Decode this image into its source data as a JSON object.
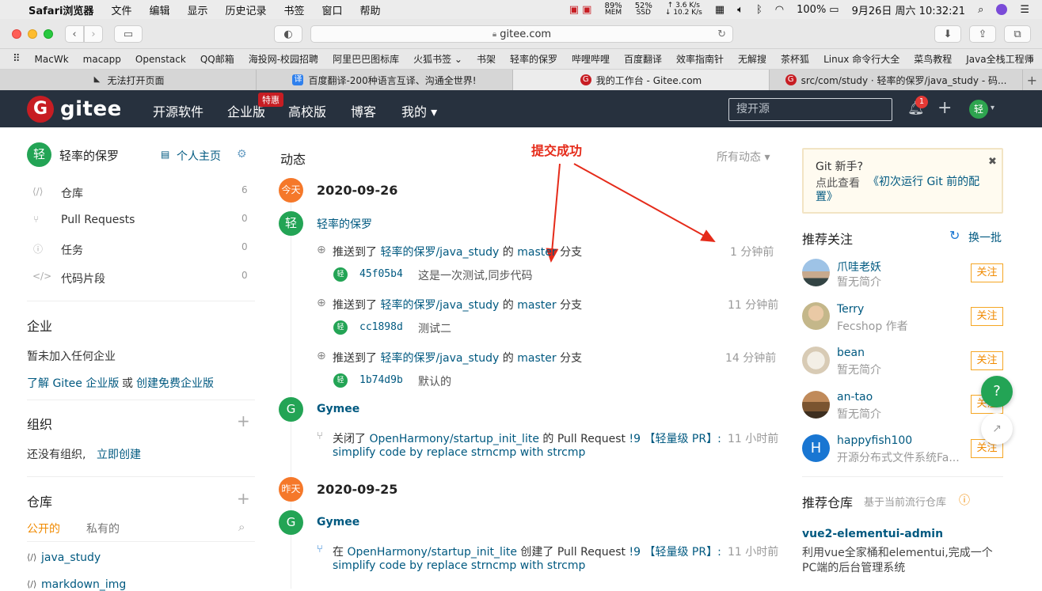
{
  "mac_menubar": {
    "app": "Safari浏览器",
    "menus": [
      "文件",
      "编辑",
      "显示",
      "历史记录",
      "书签",
      "窗口",
      "帮助"
    ],
    "mem_percent": "89%",
    "mem_label": "MEM",
    "ssd_percent": "52%",
    "ssd_label": "SSD",
    "net_up": "↑ 3.6 K/s",
    "net_down": "↓ 10.2 K/s",
    "battery": "100%",
    "datetime": "9月26日 周六  10:32:21"
  },
  "browser": {
    "url": "gitee.com",
    "bookmarks": [
      "MacWk",
      "macapp",
      "Openstack",
      "QQ邮箱",
      "海投网-校园招聘",
      "阿里巴巴图标库",
      "火狐书签 ⌄",
      "书架",
      "轻率的保罗",
      "哔哩哔哩",
      "百度翻译",
      "效率指南针",
      "无解搜",
      "茶杯狐",
      "Linux 命令行大全",
      "菜鸟教程",
      "Java全栈工程师"
    ],
    "tabs": [
      {
        "title": "无法打开页面",
        "active": false
      },
      {
        "title": "百度翻译-200种语言互译、沟通全世界!",
        "active": false
      },
      {
        "title": "我的工作台 - Gitee.com",
        "active": true
      },
      {
        "title": "src/com/study · 轻率的保罗/java_study - 码...",
        "active": false
      }
    ]
  },
  "header": {
    "logo_text": "gitee",
    "logo_letter": "G",
    "nav": [
      "开源软件",
      "企业版",
      "高校版",
      "博客",
      "我的 ▾"
    ],
    "hot_badge": "特惠",
    "search_placeholder": "搜开源",
    "notification_count": "1",
    "avatar_letter": "轻"
  },
  "sidebar": {
    "user_name": "轻率的保罗",
    "user_letter": "轻",
    "homepage_link": "个人主页",
    "stats": [
      {
        "label": "仓库",
        "count": "6"
      },
      {
        "label": "Pull Requests",
        "count": "0"
      },
      {
        "label": "任务",
        "count": "0"
      },
      {
        "label": "代码片段",
        "count": "0"
      }
    ],
    "enterprise_title": "企业",
    "enterprise_empty": "暂未加入任何企业",
    "enterprise_link1": "了解 Gitee 企业版",
    "enterprise_or": "或",
    "enterprise_link2": "创建免费企业版",
    "org_title": "组织",
    "org_empty": "还没有组织,",
    "org_create": "立即创建",
    "repo_title": "仓库",
    "repo_tab_public": "公开的",
    "repo_tab_private": "私有的",
    "repos": [
      "java_study",
      "markdown_img"
    ]
  },
  "feed": {
    "title": "动态",
    "filter": "所有动态",
    "annotation": "提交成功",
    "days": [
      {
        "badge": "今天",
        "date": "2020-09-26"
      },
      {
        "badge": "昨天",
        "date": "2020-09-25"
      }
    ],
    "user1": "轻率的保罗",
    "pushes": [
      {
        "prefix": "推送到了",
        "repo": "轻率的保罗/java_study",
        "of": "的",
        "branch": "master",
        "suffix": "分支",
        "time": "1 分钟前",
        "hash": "45f05b4",
        "msg": "这是一次测试,同步代码"
      },
      {
        "prefix": "推送到了",
        "repo": "轻率的保罗/java_study",
        "of": "的",
        "branch": "master",
        "suffix": "分支",
        "time": "11 分钟前",
        "hash": "cc1898d",
        "msg": "测试二"
      },
      {
        "prefix": "推送到了",
        "repo": "轻率的保罗/java_study",
        "of": "的",
        "branch": "master",
        "suffix": "分支",
        "time": "14 分钟前",
        "hash": "1b74d9b",
        "msg": "默认的"
      }
    ],
    "user2": "Gymee",
    "pr1": {
      "prefix": "关闭了",
      "repo": "OpenHarmony/startup_init_lite",
      "mid": "的 Pull Request",
      "num": "!9",
      "tag": "【轻量级 PR】:",
      "desc": "simplify code by replace strncmp with strcmp",
      "time": "11 小时前"
    },
    "user3": "Gymee",
    "pr2": {
      "prefix": "在",
      "repo": "OpenHarmony/startup_init_lite",
      "mid": "创建了 Pull Request",
      "num": "!9",
      "tag": "【轻量级 PR】:",
      "desc": "simplify code by replace strncmp with strcmp",
      "time": "11 小时前"
    },
    "user_letter_g": "G",
    "user_letter_q": "轻"
  },
  "right": {
    "tip_title": "Git 新手?",
    "tip_text_prefix": "点此查看",
    "tip_link": "《初次运行 Git 前的配置》",
    "recommend_title": "推荐关注",
    "refresh": "换一批",
    "follow_label": "关注",
    "users": [
      {
        "name": "爪哇老妖",
        "desc": "暂无简介"
      },
      {
        "name": "Terry",
        "desc": "Fecshop 作者"
      },
      {
        "name": "bean",
        "desc": "暂无简介"
      },
      {
        "name": "an-tao",
        "desc": "暂无简介"
      },
      {
        "name": "happyfish100",
        "desc": "开源分布式文件系统Fa...",
        "letter": "H"
      }
    ],
    "repo_title": "推荐仓库",
    "repo_subtitle": "基于当前流行仓库",
    "repo_name": "vue2-elementui-admin",
    "repo_desc": "利用vue全家桶和elementui,完成一个PC端的后台管理系统",
    "help_label": "?"
  },
  "colors": {
    "header_bg": "#27313e",
    "brand_red": "#c71d23",
    "link": "#005980",
    "green": "#23a455",
    "orange": "#f5782a",
    "annotation_red": "#e52b1a"
  }
}
